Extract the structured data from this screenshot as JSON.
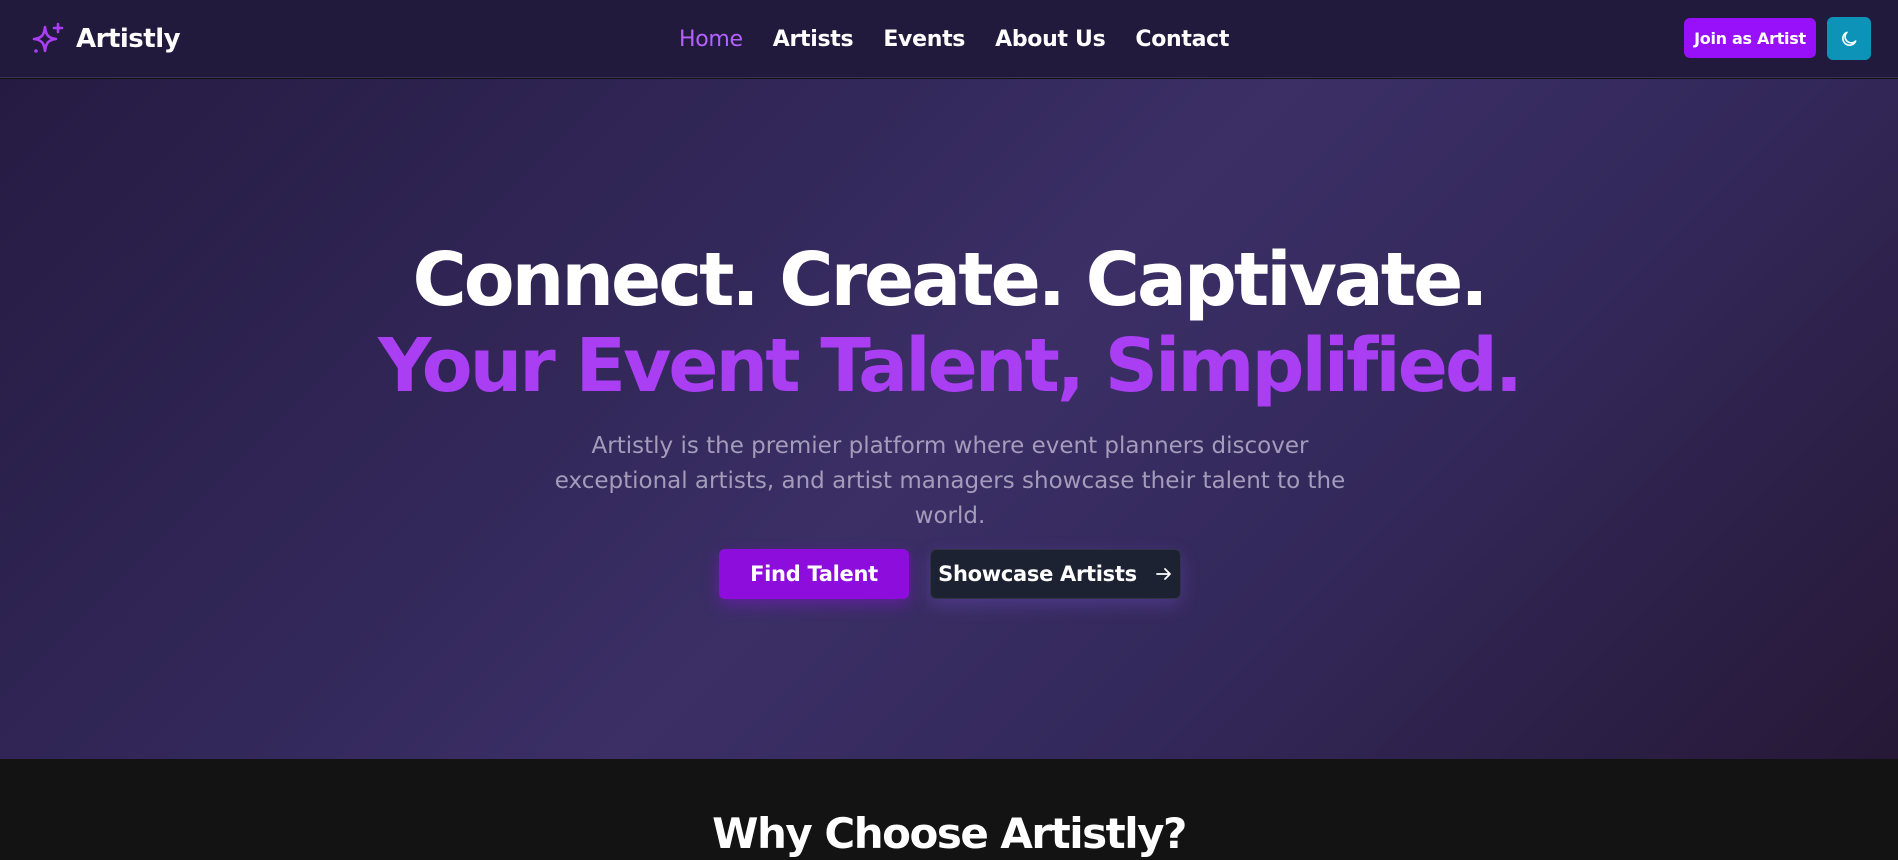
{
  "brand": {
    "name": "Artistly",
    "icon": "sparkle-icon"
  },
  "nav": {
    "items": [
      {
        "label": "Home",
        "active": true
      },
      {
        "label": "Artists",
        "active": false
      },
      {
        "label": "Events",
        "active": false
      },
      {
        "label": "About Us",
        "active": false
      },
      {
        "label": "Contact",
        "active": false
      }
    ],
    "join_label": "Join as Artist",
    "theme_icon": "moon-icon"
  },
  "hero": {
    "line1": "Connect. Create. Captivate.",
    "line2": "Your Event Talent, Simplified.",
    "subtitle": "Artistly is the premier platform where event planners discover exceptional artists, and artist managers showcase their talent to the world.",
    "primary_cta": "Find Talent",
    "secondary_cta": "Showcase Artists",
    "secondary_cta_icon": "arrow-right-icon"
  },
  "features": {
    "title": "Why Choose Artistly?"
  },
  "colors": {
    "accent": "#9810fa",
    "accent_text": "#a93ef3",
    "nav_bg": "#221a3c",
    "theme_button": "#0e93b8",
    "dark_section": "#131313"
  }
}
